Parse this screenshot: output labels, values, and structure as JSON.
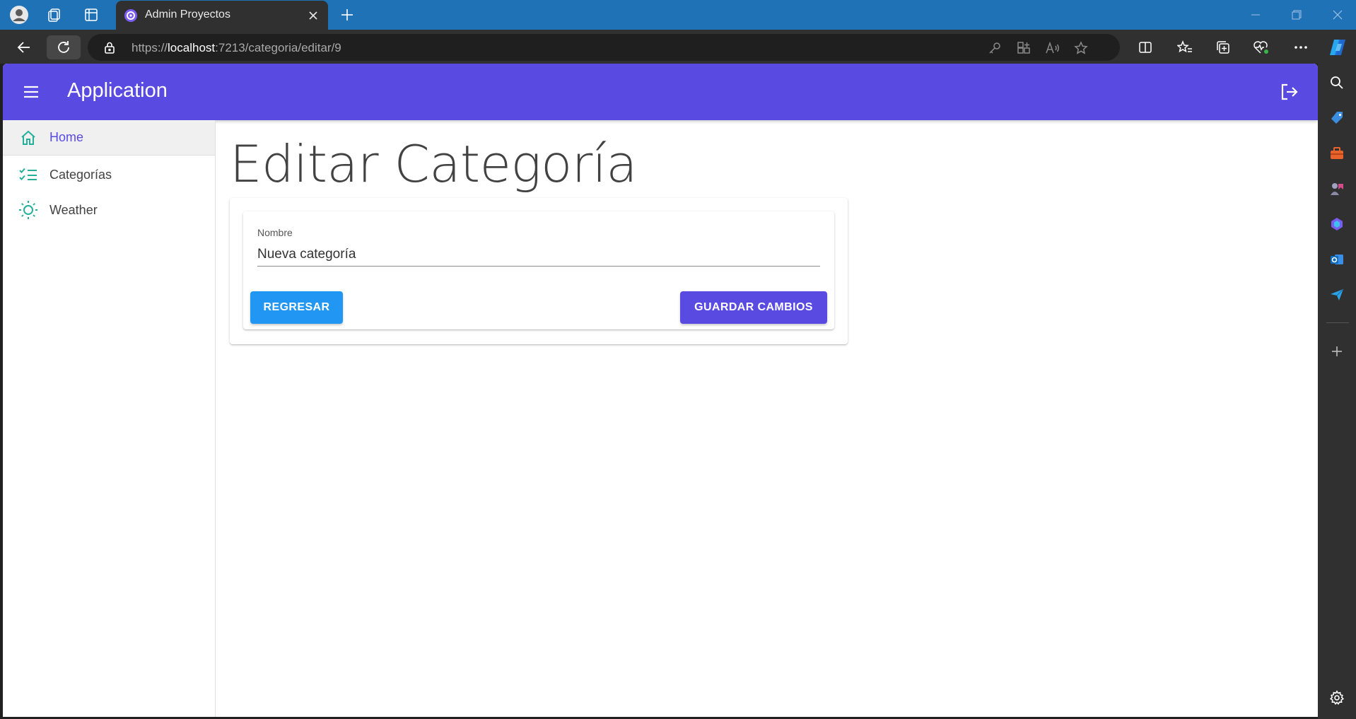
{
  "browser": {
    "tab_title": "Admin Proyectos",
    "url_scheme": "https://",
    "url_host": "localhost",
    "url_path": ":7213/categoria/editar/9"
  },
  "app": {
    "title": "Application",
    "primary_color": "#594ae2",
    "secondary_color": "#2196f3"
  },
  "nav": {
    "items": [
      {
        "label": "Home",
        "icon": "home-icon"
      },
      {
        "label": "Categorías",
        "icon": "checklist-icon"
      },
      {
        "label": "Weather",
        "icon": "sun-icon"
      }
    ]
  },
  "page": {
    "title": "Editar Categoría"
  },
  "form": {
    "nombre_label": "Nombre",
    "nombre_value": "Nueva categoría",
    "back_label": "REGRESAR",
    "save_label": "GUARDAR CAMBIOS"
  }
}
